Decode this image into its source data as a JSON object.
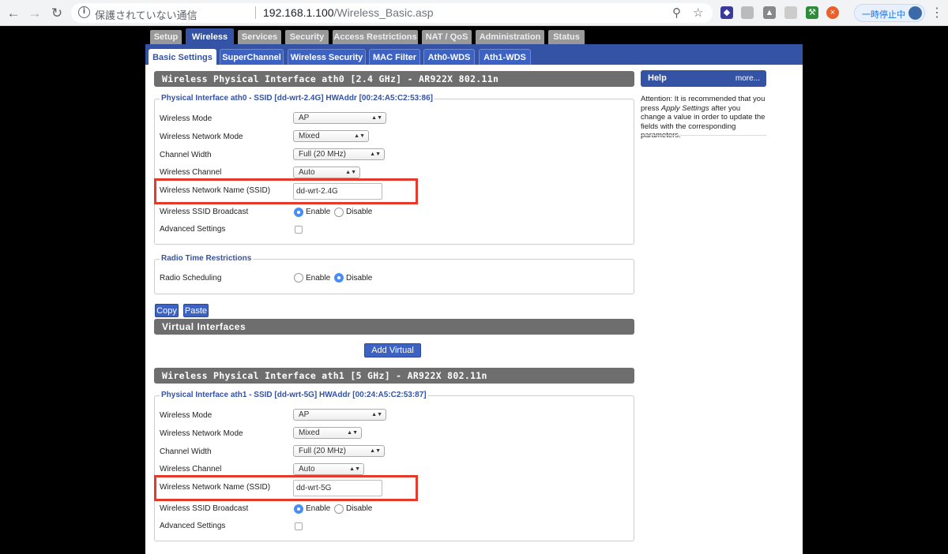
{
  "browser": {
    "insecure_label": "保護されていない通信",
    "url_host": "192.168.1.100",
    "url_path": "/Wireless_Basic.asp",
    "paused_label": "一時停止中"
  },
  "top_tabs": [
    "Setup",
    "Wireless",
    "Services",
    "Security",
    "Access Restrictions",
    "NAT / QoS",
    "Administration",
    "Status"
  ],
  "sub_tabs": [
    "Basic Settings",
    "SuperChannel",
    "Wireless Security",
    "MAC Filter",
    "Ath0-WDS",
    "Ath1-WDS"
  ],
  "iface0": {
    "title": "Wireless Physical Interface ath0 [2.4 GHz] - AR922X 802.11n",
    "legend": "Physical Interface ath0 - SSID [dd-wrt-2.4G] HWAddr [00:24:A5:C2:53:86]",
    "mode_label": "Wireless Mode",
    "mode_value": "AP",
    "netmode_label": "Wireless Network Mode",
    "netmode_value": "Mixed",
    "width_label": "Channel Width",
    "width_value": "Full (20 MHz)",
    "channel_label": "Wireless Channel",
    "channel_value": "Auto",
    "ssid_label": "Wireless Network Name (SSID)",
    "ssid_value": "dd-wrt-2.4G",
    "broadcast_label": "Wireless SSID Broadcast",
    "enable": "Enable",
    "disable": "Disable",
    "advanced_label": "Advanced Settings"
  },
  "radio_time": {
    "legend": "Radio Time Restrictions",
    "scheduling_label": "Radio Scheduling",
    "enable": "Enable",
    "disable": "Disable"
  },
  "buttons": {
    "copy": "Copy",
    "paste": "Paste",
    "add_vap": "Add Virtual AP"
  },
  "virtual_interfaces_title": "Virtual Interfaces",
  "iface1": {
    "title": "Wireless Physical Interface ath1 [5 GHz] - AR922X 802.11n",
    "legend": "Physical Interface ath1 - SSID [dd-wrt-5G] HWAddr [00:24:A5:C2:53:87]",
    "mode_label": "Wireless Mode",
    "mode_value": "AP",
    "netmode_label": "Wireless Network Mode",
    "netmode_value": "Mixed",
    "width_label": "Channel Width",
    "width_value": "Full (20 MHz)",
    "channel_label": "Wireless Channel",
    "channel_value": "Auto",
    "ssid_label": "Wireless Network Name (SSID)",
    "ssid_value": "dd-wrt-5G",
    "broadcast_label": "Wireless SSID Broadcast",
    "enable": "Enable",
    "disable": "Disable",
    "advanced_label": "Advanced Settings"
  },
  "help": {
    "title": "Help",
    "more": "more...",
    "text_1": "Attention: It is recommended that you press ",
    "text_em": "Apply Settings",
    "text_2": " after you change a value in order to update the fields with the corresponding parameters."
  },
  "colors": {
    "accent": "#3453a5",
    "highlight": "#e53a2a"
  },
  "icons": [
    "back-icon",
    "forward-icon",
    "reload-icon",
    "info-icon",
    "key-icon",
    "star-icon",
    "extension-icons",
    "avatar-icon",
    "menu-icon"
  ]
}
